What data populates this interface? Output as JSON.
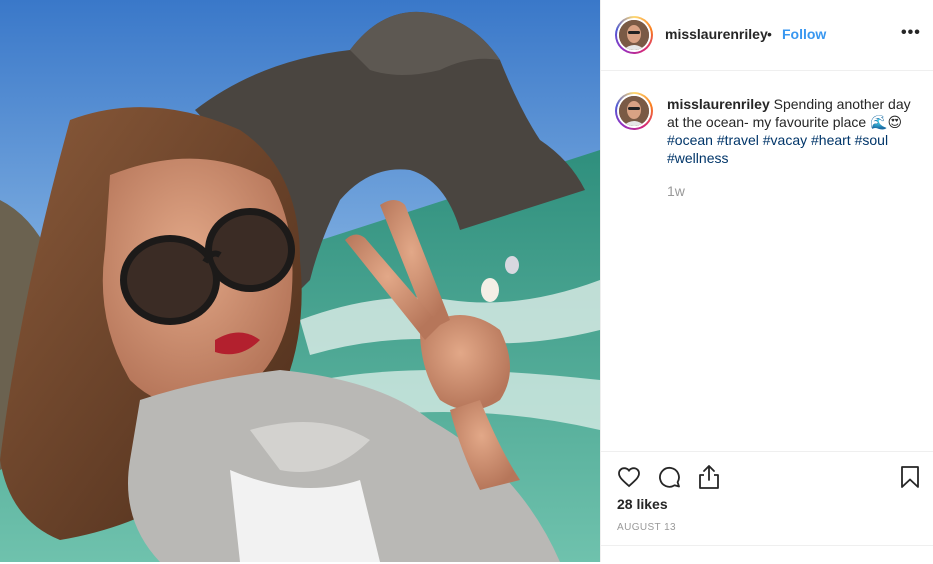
{
  "post": {
    "username": "misslaurenriley",
    "separator": "•",
    "follow_label": "Follow",
    "more_label": "•••",
    "caption_text": " Spending another day at the ocean- my favourite place 🌊😍",
    "hashtags": [
      "#ocean",
      "#travel",
      "#vacay",
      "#heart",
      "#soul",
      "#wellness"
    ],
    "time_ago": "1w",
    "likes": "28 likes",
    "date": "AUGUST 13"
  },
  "icons": {
    "avatar": "avatar-icon",
    "more": "more-options-icon",
    "heart": "heart-icon",
    "comment": "comment-icon",
    "share": "share-icon",
    "save": "bookmark-icon"
  },
  "colors": {
    "link_blue": "#3897f0",
    "hashtag": "#003569",
    "muted": "#999999",
    "text": "#262626",
    "border": "#efefef"
  }
}
